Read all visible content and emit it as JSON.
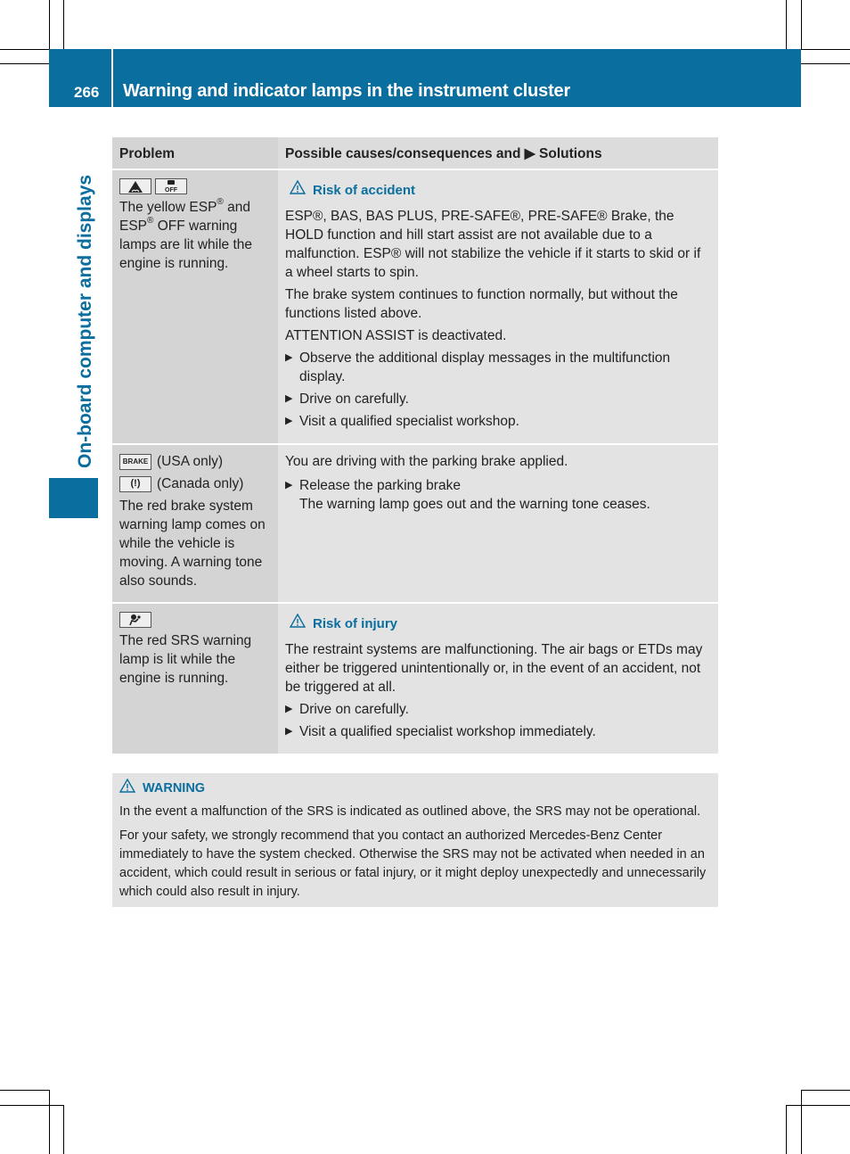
{
  "header": {
    "page_number": "266",
    "title": "Warning and indicator lamps in the instrument cluster",
    "section_tab": "On-board computer and displays"
  },
  "colors": {
    "brand_blue": "#0a6e9e",
    "cell_dark": "#d4d4d4",
    "cell_light": "#e3e3e3"
  },
  "table": {
    "headers": {
      "problem": "Problem",
      "solutions": "Possible causes/consequences and ▶ Solutions"
    },
    "rows": [
      {
        "lamps": [
          "esp-warning-icon",
          "esp-off-icon"
        ],
        "problem_text": {
          "a": "The yellow ESP",
          "b": " and ESP",
          "c": " OFF warning lamps are lit while the engine is running."
        },
        "registered": "®",
        "warning_title": "Risk of accident",
        "paragraphs": [
          "ESP®, BAS, BAS PLUS, PRE-SAFE®, PRE-SAFE® Brake, the HOLD function and hill start assist are not available due to a malfunction. ESP® will not stabilize the vehicle if it starts to skid or if a wheel starts to spin.",
          "The brake system continues to function normally, but without the functions listed above.",
          "ATTENTION ASSIST is deactivated."
        ],
        "bullets": [
          "Observe the additional display messages in the multifunction display.",
          "Drive on carefully.",
          "Visit a qualified specialist workshop."
        ]
      },
      {
        "lamps": [
          {
            "icon": "brake-text-icon",
            "glyph": "BRAKE",
            "label": "(USA only)"
          },
          {
            "icon": "brake-circle-icon",
            "glyph": "(ⓘ)",
            "label": "(Canada only)"
          }
        ],
        "problem_text": "The red brake system warning lamp comes on while the vehicle is moving. A warning tone also sounds.",
        "paragraphs": [
          "You are driving with the parking brake applied."
        ],
        "bullets": [
          "Release the parking brake"
        ],
        "result": "The warning lamp goes out and the warning tone ceases."
      },
      {
        "lamps": [
          "srs-airbag-icon"
        ],
        "problem_text": "The red SRS warning lamp is lit while the engine is running.",
        "warning_title": "Risk of injury",
        "paragraphs": [
          "The restraint systems are malfunctioning. The air bags or ETDs may either be triggered unintentionally or, in the event of an accident, not be triggered at all."
        ],
        "bullets": [
          "Drive on carefully.",
          "Visit a qualified specialist workshop immediately."
        ]
      }
    ]
  },
  "warning_box": {
    "title": "WARNING",
    "paragraphs": [
      "In the event a malfunction of the SRS is indicated as outlined above, the SRS may not be operational.",
      "For your safety, we strongly recommend that you contact an authorized Mercedes-Benz Center immediately to have the system checked. Otherwise the SRS may not be activated when needed in an accident, which could result in serious or fatal injury, or it might deploy unexpectedly and unnecessarily which could also result in injury."
    ]
  },
  "glyphs": {
    "bullet": "▶",
    "brake_text": "BRAKE",
    "brake_circle": "(!)"
  }
}
